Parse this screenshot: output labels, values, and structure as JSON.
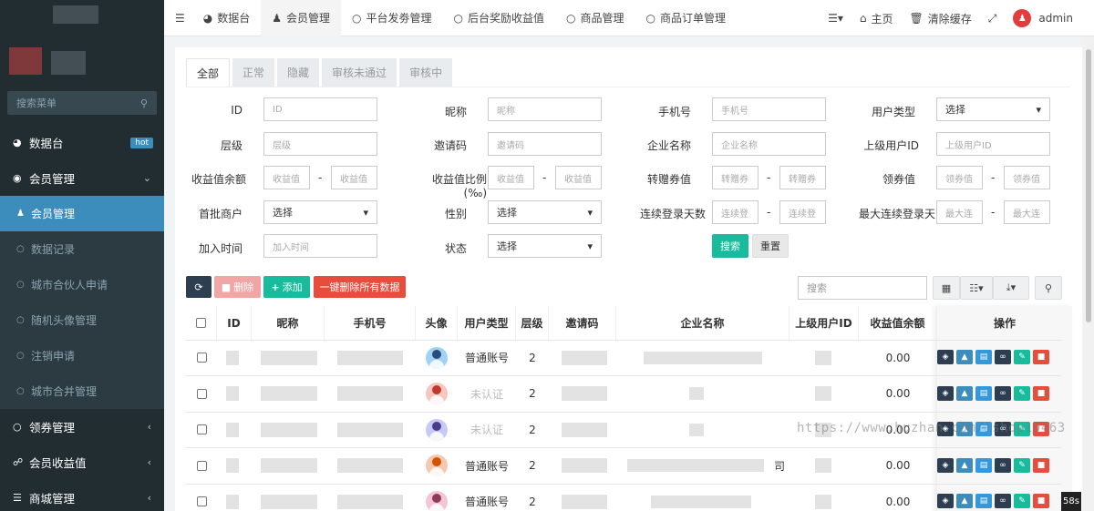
{
  "sidebar": {
    "search_placeholder": "搜索菜单",
    "items": [
      {
        "label": "数据台",
        "badge": "hot"
      },
      {
        "label": "会员管理"
      },
      {
        "label": "领券管理"
      },
      {
        "label": "会员收益值"
      },
      {
        "label": "商城管理"
      }
    ],
    "sub_items": [
      {
        "label": "会员管理"
      },
      {
        "label": "数据记录"
      },
      {
        "label": "城市合伙人申请"
      },
      {
        "label": "随机头像管理"
      },
      {
        "label": "注销申请"
      },
      {
        "label": "城市合并管理"
      }
    ]
  },
  "topnav": {
    "tabs": [
      {
        "label": "数据台"
      },
      {
        "label": "会员管理"
      },
      {
        "label": "平台发劵管理"
      },
      {
        "label": "后台奖励收益值"
      },
      {
        "label": "商品管理"
      },
      {
        "label": "商品订单管理"
      }
    ],
    "home": "主页",
    "clear_cache": "清除缓存",
    "user": "admin"
  },
  "filter_tabs": [
    "全部",
    "正常",
    "隐藏",
    "审核未通过",
    "审核中"
  ],
  "filters": {
    "id_label": "ID",
    "id_ph": "ID",
    "nickname_label": "昵称",
    "nickname_ph": "昵称",
    "phone_label": "手机号",
    "phone_ph": "手机号",
    "usertype_label": "用户类型",
    "select": "选择",
    "level_label": "层级",
    "level_ph": "层级",
    "invite_label": "邀请码",
    "invite_ph": "邀请码",
    "company_label": "企业名称",
    "company_ph": "企业名称",
    "parent_label": "上级用户ID",
    "parent_ph": "上级用户ID",
    "balance_label": "收益值余额",
    "balance_ph": "收益值",
    "ratio_label": "收益值比例(‰)",
    "ratio_ph": "收益值",
    "gift_label": "转赠券值",
    "gift_ph": "转赠券",
    "coupon_label": "领券值",
    "coupon_ph": "领券值",
    "merchant_label": "首批商户",
    "gender_label": "性别",
    "login_days_label": "连续登录天数",
    "login_days_ph": "连续登",
    "max_login_label": "最大连续登录天",
    "max_login_ph": "最大连",
    "join_label": "加入时间",
    "join_ph": "加入时间",
    "status_label": "状态",
    "search_btn": "搜索",
    "reset_btn": "重置",
    "dash": "-"
  },
  "toolbar": {
    "delete": "删除",
    "add": "添加",
    "delete_all": "一键删除所有数据",
    "search_ph": "搜索"
  },
  "table": {
    "headers": [
      "ID",
      "昵称",
      "手机号",
      "头像",
      "用户类型",
      "层级",
      "邀请码",
      "企业名称",
      "上级用户ID",
      "收益值余额",
      "操作"
    ],
    "rows": [
      {
        "type": "普通账号",
        "level": "2",
        "balance": "0.00"
      },
      {
        "type": "未认证",
        "level": "2",
        "balance": "0.00"
      },
      {
        "type": "未认证",
        "level": "2",
        "balance": "0.00"
      },
      {
        "type": "普通账号",
        "level": "2",
        "balance": "0.00",
        "company_suffix": "司"
      },
      {
        "type": "普通账号",
        "level": "2",
        "balance": "0.00"
      }
    ]
  },
  "watermark": "https://www.huzhan.com/ishop10463",
  "timer": "58s",
  "colors": {
    "sidebar": "#222d32",
    "accent": "#3c8dbc",
    "green": "#18bc9c",
    "red": "#e74c3c"
  }
}
